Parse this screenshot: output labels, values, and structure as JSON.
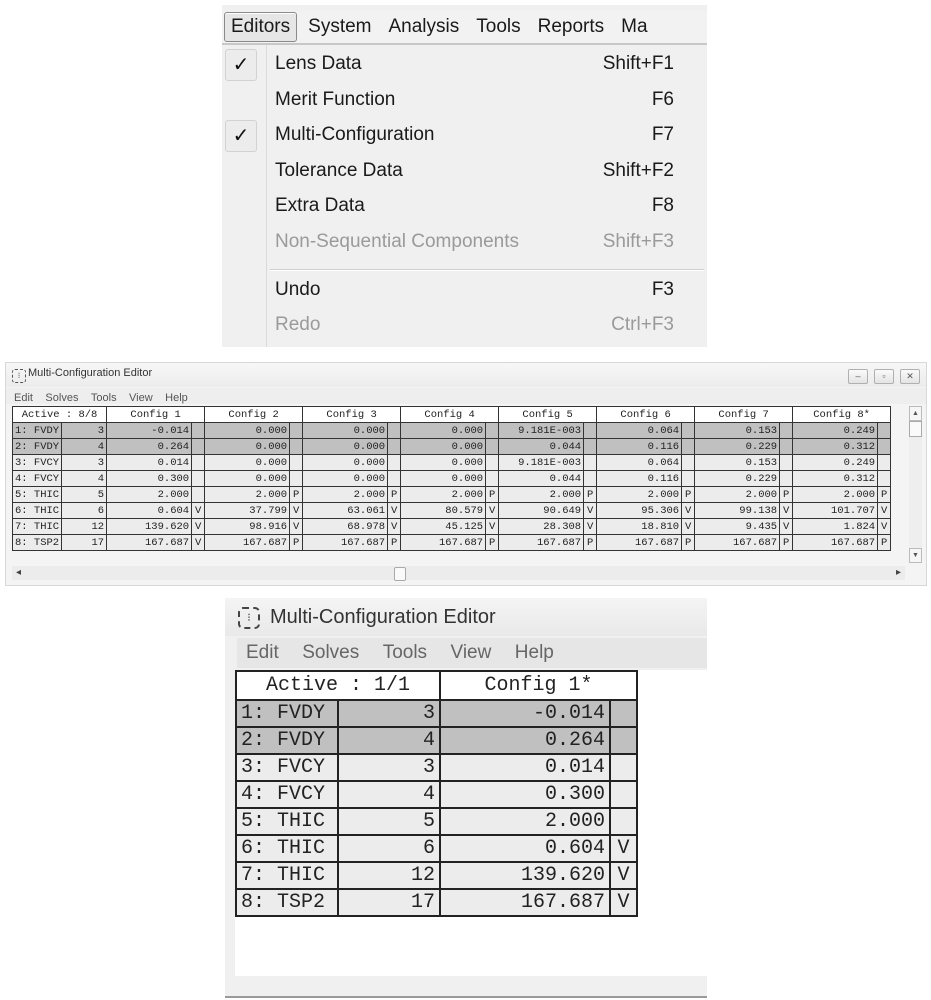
{
  "editors_menu": {
    "menubar": [
      "Editors",
      "System",
      "Analysis",
      "Tools",
      "Reports",
      "Ma"
    ],
    "active_menu": "Editors",
    "items": [
      {
        "label": "Lens Data",
        "shortcut": "Shift+F1",
        "checked": true,
        "enabled": true,
        "check_glyph": "✓"
      },
      {
        "label": "Merit Function",
        "shortcut": "F6",
        "checked": false,
        "enabled": true
      },
      {
        "label": "Multi-Configuration",
        "shortcut": "F7",
        "checked": true,
        "enabled": true,
        "check_glyph": "✓"
      },
      {
        "label": "Tolerance Data",
        "shortcut": "Shift+F2",
        "checked": false,
        "enabled": true
      },
      {
        "label": "Extra Data",
        "shortcut": "F8",
        "checked": false,
        "enabled": true
      },
      {
        "label": "Non-Sequential Components",
        "shortcut": "Shift+F3",
        "checked": false,
        "enabled": false
      },
      {
        "label": "Undo",
        "shortcut": "F3",
        "checked": false,
        "enabled": true
      },
      {
        "label": "Redo",
        "shortcut": "Ctrl+F3",
        "checked": false,
        "enabled": false
      }
    ]
  },
  "mce_large": {
    "title": "Multi-Configuration Editor",
    "window_buttons": {
      "minimize": "–",
      "restore": "▫",
      "close": "✕"
    },
    "menu": [
      "Edit",
      "Solves",
      "Tools",
      "View",
      "Help"
    ],
    "active_label": "Active : 8/8",
    "config_headers": [
      "Config 1",
      "Config 2",
      "Config 3",
      "Config 4",
      "Config 5",
      "Config 6",
      "Config 7",
      "Config 8*"
    ],
    "rows": [
      {
        "op": "1: FVDY",
        "param": "3",
        "selected": true,
        "values": [
          [
            "-0.014",
            ""
          ],
          [
            "0.000",
            ""
          ],
          [
            "0.000",
            ""
          ],
          [
            "0.000",
            ""
          ],
          [
            "9.181E-003",
            ""
          ],
          [
            "0.064",
            ""
          ],
          [
            "0.153",
            ""
          ],
          [
            "0.249",
            ""
          ]
        ]
      },
      {
        "op": "2: FVDY",
        "param": "4",
        "selected": true,
        "values": [
          [
            "0.264",
            ""
          ],
          [
            "0.000",
            ""
          ],
          [
            "0.000",
            ""
          ],
          [
            "0.000",
            ""
          ],
          [
            "0.044",
            ""
          ],
          [
            "0.116",
            ""
          ],
          [
            "0.229",
            ""
          ],
          [
            "0.312",
            ""
          ]
        ]
      },
      {
        "op": "3: FVCY",
        "param": "3",
        "selected": false,
        "values": [
          [
            "0.014",
            ""
          ],
          [
            "0.000",
            ""
          ],
          [
            "0.000",
            ""
          ],
          [
            "0.000",
            ""
          ],
          [
            "9.181E-003",
            ""
          ],
          [
            "0.064",
            ""
          ],
          [
            "0.153",
            ""
          ],
          [
            "0.249",
            ""
          ]
        ]
      },
      {
        "op": "4: FVCY",
        "param": "4",
        "selected": false,
        "values": [
          [
            "0.300",
            ""
          ],
          [
            "0.000",
            ""
          ],
          [
            "0.000",
            ""
          ],
          [
            "0.000",
            ""
          ],
          [
            "0.044",
            ""
          ],
          [
            "0.116",
            ""
          ],
          [
            "0.229",
            ""
          ],
          [
            "0.312",
            ""
          ]
        ]
      },
      {
        "op": "5: THIC",
        "param": "5",
        "selected": false,
        "values": [
          [
            "2.000",
            ""
          ],
          [
            "2.000",
            "P"
          ],
          [
            "2.000",
            "P"
          ],
          [
            "2.000",
            "P"
          ],
          [
            "2.000",
            "P"
          ],
          [
            "2.000",
            "P"
          ],
          [
            "2.000",
            "P"
          ],
          [
            "2.000",
            "P"
          ]
        ]
      },
      {
        "op": "6: THIC",
        "param": "6",
        "selected": false,
        "values": [
          [
            "0.604",
            "V"
          ],
          [
            "37.799",
            "V"
          ],
          [
            "63.061",
            "V"
          ],
          [
            "80.579",
            "V"
          ],
          [
            "90.649",
            "V"
          ],
          [
            "95.306",
            "V"
          ],
          [
            "99.138",
            "V"
          ],
          [
            "101.707",
            "V"
          ]
        ]
      },
      {
        "op": "7: THIC",
        "param": "12",
        "selected": false,
        "values": [
          [
            "139.620",
            "V"
          ],
          [
            "98.916",
            "V"
          ],
          [
            "68.978",
            "V"
          ],
          [
            "45.125",
            "V"
          ],
          [
            "28.308",
            "V"
          ],
          [
            "18.810",
            "V"
          ],
          [
            "9.435",
            "V"
          ],
          [
            "1.824",
            "V"
          ]
        ]
      },
      {
        "op": "8: TSP2",
        "param": "17",
        "selected": false,
        "values": [
          [
            "167.687",
            "V"
          ],
          [
            "167.687",
            "P"
          ],
          [
            "167.687",
            "P"
          ],
          [
            "167.687",
            "P"
          ],
          [
            "167.687",
            "P"
          ],
          [
            "167.687",
            "P"
          ],
          [
            "167.687",
            "P"
          ],
          [
            "167.687",
            "P"
          ]
        ]
      }
    ],
    "scroll": {
      "up": "▲",
      "down": "▼",
      "left": "◂",
      "right": "▸"
    }
  },
  "mce_small": {
    "title": "Multi-Configuration Editor",
    "menu": [
      "Edit",
      "Solves",
      "Tools",
      "View",
      "Help"
    ],
    "active_label": "Active : 1/1",
    "config_headers": [
      "Config 1*"
    ],
    "rows": [
      {
        "op": "1: FVDY",
        "param": "3",
        "selected": true,
        "values": [
          [
            "-0.014",
            ""
          ]
        ]
      },
      {
        "op": "2: FVDY",
        "param": "4",
        "selected": true,
        "values": [
          [
            "0.264",
            ""
          ]
        ]
      },
      {
        "op": "3: FVCY",
        "param": "3",
        "selected": false,
        "values": [
          [
            "0.014",
            ""
          ]
        ]
      },
      {
        "op": "4: FVCY",
        "param": "4",
        "selected": false,
        "values": [
          [
            "0.300",
            ""
          ]
        ]
      },
      {
        "op": "5: THIC",
        "param": "5",
        "selected": false,
        "values": [
          [
            "2.000",
            ""
          ]
        ]
      },
      {
        "op": "6: THIC",
        "param": "6",
        "selected": false,
        "values": [
          [
            "0.604",
            "V"
          ]
        ]
      },
      {
        "op": "7: THIC",
        "param": "12",
        "selected": false,
        "values": [
          [
            "139.620",
            "V"
          ]
        ]
      },
      {
        "op": "8: TSP2",
        "param": "17",
        "selected": false,
        "values": [
          [
            "167.687",
            "V"
          ]
        ]
      }
    ]
  },
  "icons": {
    "app_icon": "⁝"
  }
}
